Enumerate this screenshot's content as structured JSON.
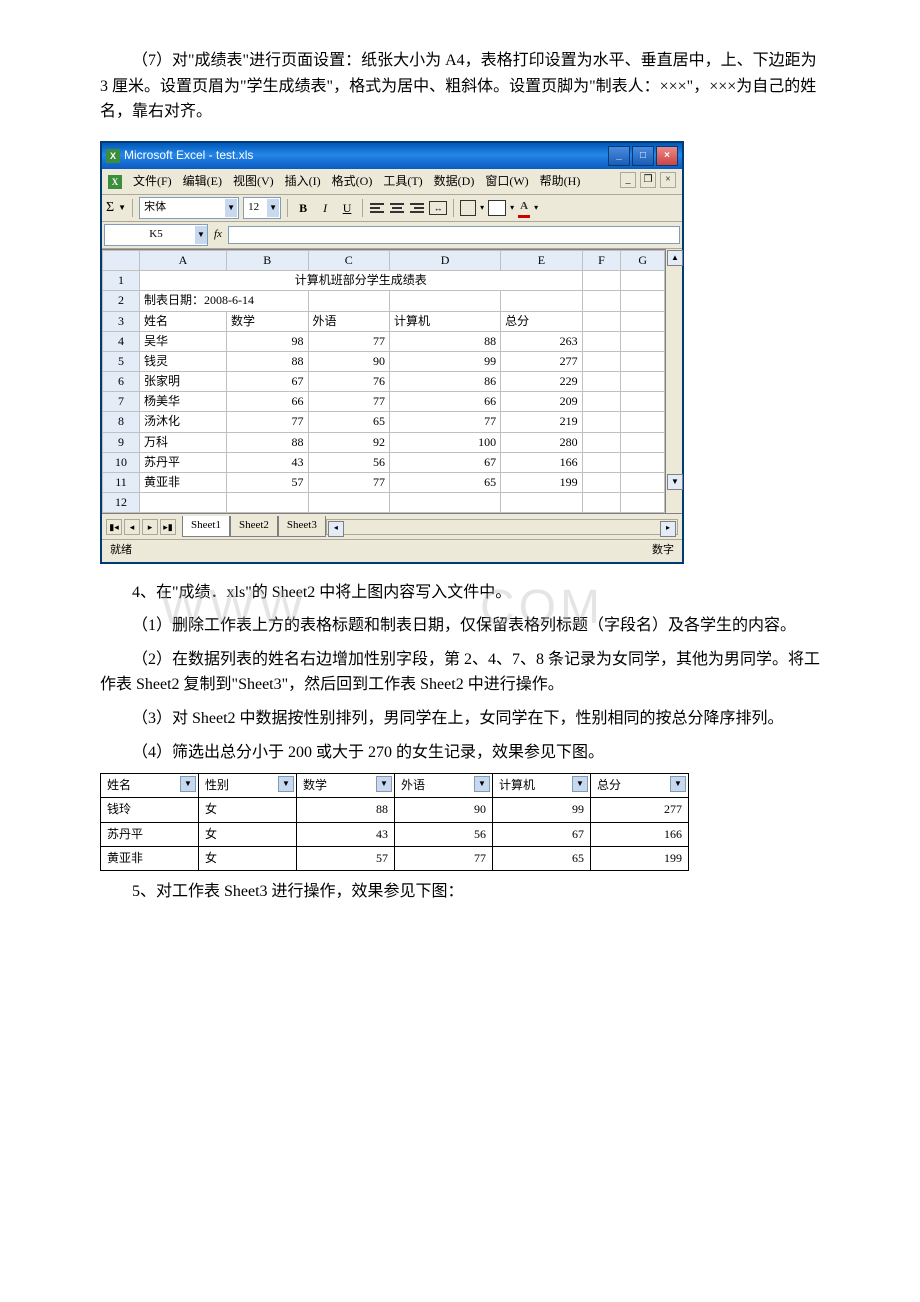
{
  "intro": {
    "paragraph7": "（7）对\"成绩表\"进行页面设置：纸张大小为 A4，表格打印设置为水平、垂直居中，上、下边距为 3 厘米。设置页眉为\"学生成绩表\"，格式为居中、粗斜体。设置页脚为\"制表人：×××\"，×××为自己的姓名，靠右对齐。"
  },
  "excel": {
    "title": "Microsoft Excel - test.xls",
    "menus": [
      "文件(F)",
      "编辑(E)",
      "视图(V)",
      "插入(I)",
      "格式(O)",
      "工具(T)",
      "数据(D)",
      "窗口(W)",
      "帮助(H)"
    ],
    "font_name": "宋体",
    "font_size": "12",
    "name_box": "K5",
    "columns": [
      "A",
      "B",
      "C",
      "D",
      "E",
      "F",
      "G"
    ],
    "row_count": 12,
    "title_cell": "计算机班部分学生成绩表",
    "date_row": "制表日期：2008-6-14",
    "headers": [
      "姓名",
      "数学",
      "外语",
      "计算机",
      "总分"
    ],
    "rows": [
      [
        "吴华",
        98,
        77,
        88,
        263
      ],
      [
        "钱灵",
        88,
        90,
        99,
        277
      ],
      [
        "张家明",
        67,
        76,
        86,
        229
      ],
      [
        "杨美华",
        66,
        77,
        66,
        209
      ],
      [
        "汤沐化",
        77,
        65,
        77,
        219
      ],
      [
        "万科",
        88,
        92,
        100,
        280
      ],
      [
        "苏丹平",
        43,
        56,
        67,
        166
      ],
      [
        "黄亚非",
        57,
        77,
        65,
        199
      ]
    ],
    "sheets": [
      "Sheet1",
      "Sheet2",
      "Sheet3"
    ],
    "status_left": "就绪",
    "status_right": "数字"
  },
  "section4": {
    "heading": "4、在\"成绩．xls\"的 Sheet2 中将上图内容写入文件中。",
    "p1": "（1）删除工作表上方的表格标题和制表日期，仅保留表格列标题（字段名）及各学生的内容。",
    "p2": "（2）在数据列表的姓名右边增加性别字段，第 2、4、7、8 条记录为女同学，其他为男同学。将工作表 Sheet2 复制到\"Sheet3\"，然后回到工作表 Sheet2 中进行操作。",
    "p3": "（3）对 Sheet2 中数据按性别排列，男同学在上，女同学在下，性别相同的按总分降序排列。",
    "p4": "（4）筛选出总分小于 200 或大于 270 的女生记录，效果参见下图。"
  },
  "filter": {
    "headers": [
      "姓名",
      "性别",
      "数学",
      "外语",
      "计算机",
      "总分"
    ],
    "rows": [
      [
        "钱玲",
        "女",
        88,
        90,
        99,
        277
      ],
      [
        "苏丹平",
        "女",
        43,
        56,
        67,
        166
      ],
      [
        "黄亚非",
        "女",
        57,
        77,
        65,
        199
      ]
    ]
  },
  "section5": "5、对工作表 Sheet3 进行操作，效果参见下图：",
  "watermark": {
    "left": "WWW",
    "right": "COM"
  }
}
